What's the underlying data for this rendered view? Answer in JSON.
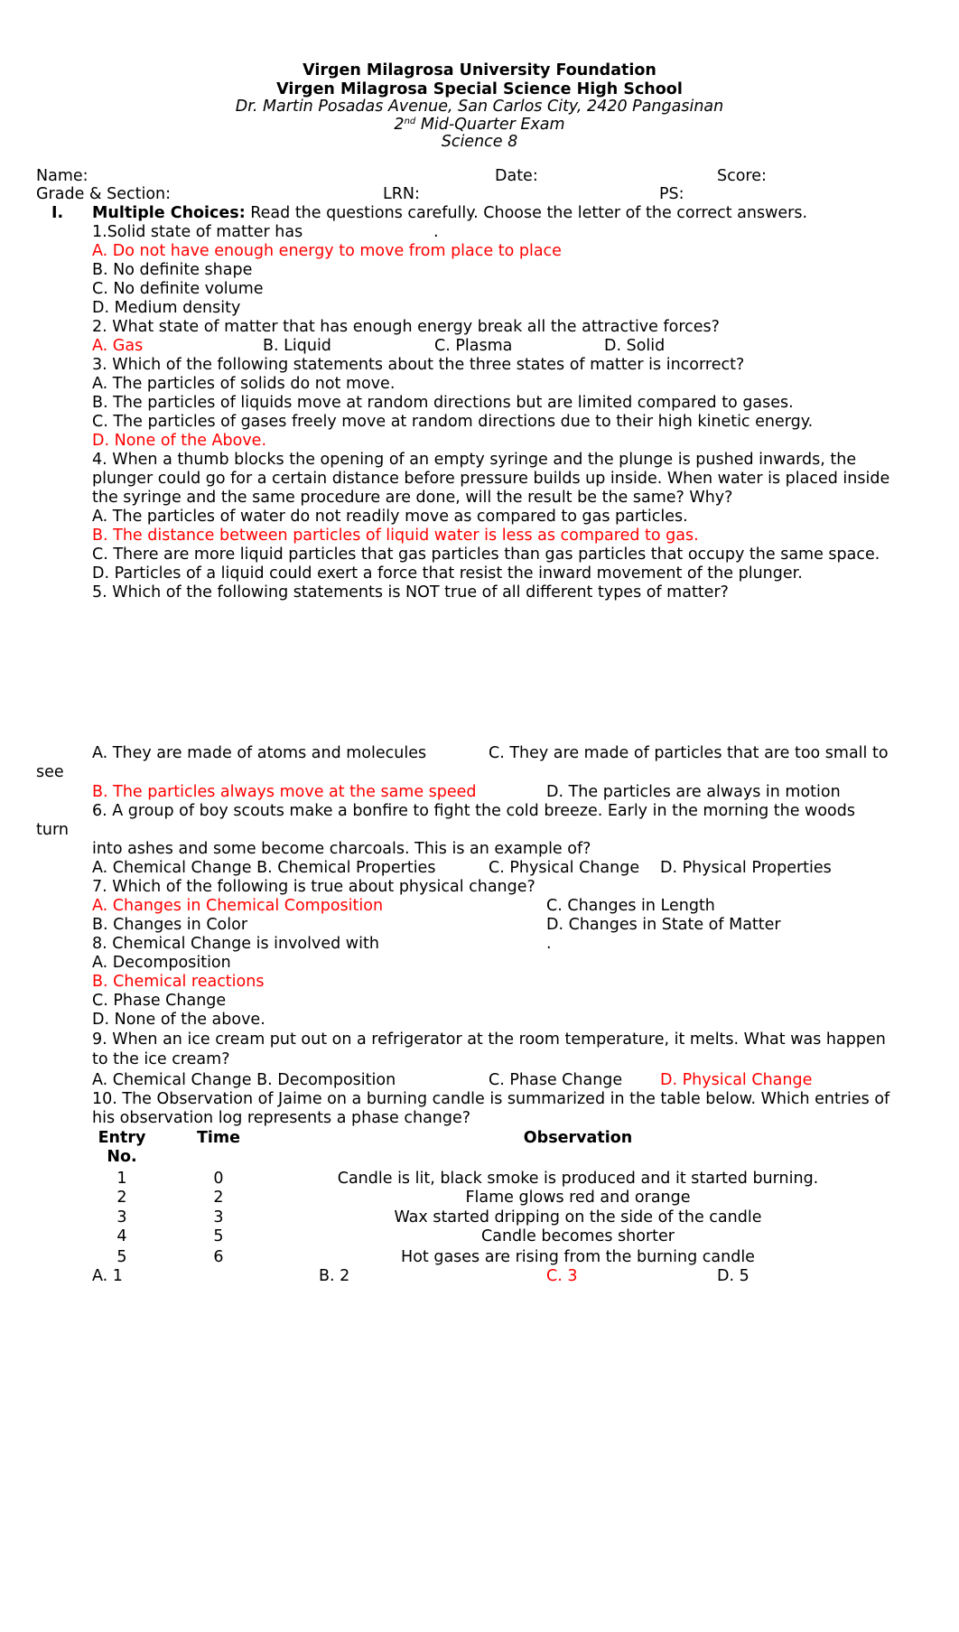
{
  "header": {
    "org": "Virgen Milagrosa University Foundation",
    "school": "Virgen Milagrosa Special Science High School",
    "address": "Dr. Martin Posadas Avenue, San Carlos City, 2420 Pangasinan",
    "exam_ordinal": "2",
    "exam_ordinal_suffix": "nd",
    "exam_title": "Mid-Quarter Exam",
    "subject": "Science 8"
  },
  "fields": {
    "name": "Name:",
    "date": "Date:",
    "score": "Score:",
    "grade_section": "Grade & Section:",
    "lrn": "LRN:",
    "ps": "PS:"
  },
  "section": {
    "numeral": "I.",
    "title": "Multiple Choices:",
    "instructions": "Read the questions carefully. Choose the letter of the correct answers."
  },
  "answer_color": "#ff0000",
  "lines": {
    "q1": "1.Solid state of matter has",
    "q1_dot": ".",
    "q1a": "A. Do not have enough energy to move from place to place",
    "q1b": "B. No definite shape",
    "q1c": "C. No definite volume",
    "q1d": "D. Medium density",
    "q2": "2. What state of matter that has enough energy break all the attractive forces?",
    "q2a": "A. Gas",
    "q2b": "B. Liquid",
    "q2c": "C. Plasma",
    "q2d": "D. Solid",
    "q3": "3. Which of the following statements about the three states of matter is incorrect?",
    "q3a": "A. The particles of solids do not move.",
    "q3b": "B. The particles of liquids move at random directions but are limited compared to gases.",
    "q3c": "C. The particles of gases freely move at random directions due to their high kinetic energy.",
    "q3d": "D. None of the Above.",
    "q4_l1": "4. When a thumb blocks the opening of an empty syringe and the plunge is pushed inwards, the",
    "q4_l2": "plunger could go for a certain distance before pressure builds up inside. When water is placed inside",
    "q4_l3": "the syringe and the same procedure are done, will the result be the same? Why?",
    "q4a": "A. The particles of water do not readily move as compared to gas particles.",
    "q4b": "B. The distance between particles of liquid water is less as compared to gas.",
    "q4c": "C. There are more liquid particles that gas particles than gas particles that occupy the same space.",
    "q4d": "D. Particles of a liquid could exert a force that resist the inward movement of the plunger.",
    "q5": "5. Which of the following statements is NOT true of all different types of matter?",
    "q5a": "A. They are made of atoms and molecules",
    "q5c": "C. They are made of particles that are too small to",
    "q5c_wrap": "see",
    "q5b": "B. The particles always move at the same speed",
    "q5d": "D. The particles are always in motion",
    "q6_l1": "6. A group of boy scouts make a bonfire to fight the cold breeze. Early in the morning the woods",
    "q6_wrap": "turn",
    "q6_l2": "into ashes and some become charcoals. This is an example of?",
    "q6ab": "A. Chemical Change B. Chemical Properties",
    "q6c": "C. Physical Change",
    "q6d": "D. Physical Properties",
    "q7": "7. Which of the following is true about physical change?",
    "q7a": "A. Changes in Chemical Composition",
    "q7c": "C. Changes in Length",
    "q7b": "B. Changes in Color",
    "q7d": "D. Changes in State of Matter",
    "q8": "8. Chemical Change is involved with",
    "q8_dot": ".",
    "q8a": "A. Decomposition",
    "q8b": "B. Chemical reactions",
    "q8c": "C. Phase Change",
    "q8d": "D. None of the above.",
    "q9_l1": "9. When an ice cream put out on a refrigerator at the room temperature, it melts. What was happen",
    "q9_l2": "to the ice cream?",
    "q9ab": "A. Chemical Change B. Decomposition",
    "q9c": "C. Phase Change",
    "q9d": "D. Physical Change",
    "q10_l1": "10. The Observation of Jaime on a burning candle is summarized in the table below. Which entries of",
    "q10_l2": "his observation log represents a phase change?",
    "q10a": "A. 1",
    "q10b": "B. 2",
    "q10c": "C. 3",
    "q10d": "D. 5"
  },
  "table": {
    "headers": {
      "entry_l1": "Entry",
      "entry_l2": "No.",
      "time": "Time",
      "observation": "Observation"
    },
    "rows": [
      {
        "entry": "1",
        "time": "0",
        "observation": "Candle is lit, black smoke is produced and it started burning."
      },
      {
        "entry": "2",
        "time": "2",
        "observation": "Flame glows red and orange"
      },
      {
        "entry": "3",
        "time": "3",
        "observation": "Wax started dripping on the side of the candle"
      },
      {
        "entry": "4",
        "time": "5",
        "observation": "Candle becomes shorter"
      },
      {
        "entry": "5",
        "time": "6",
        "observation": "Hot gases are rising from the burning candle"
      }
    ]
  }
}
